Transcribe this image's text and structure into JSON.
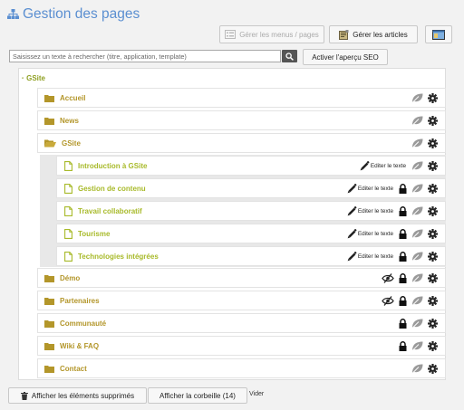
{
  "header": {
    "title": "Gestion des pages",
    "manage_menus_label": "Gérer les menus / pages",
    "manage_articles_label": "Gérer les articles"
  },
  "search": {
    "placeholder": "Saisissez un texte à rechercher (titre, application, template)",
    "value": "",
    "seo_label": "Activer l'aperçu SEO"
  },
  "tree": {
    "root": {
      "label": "GSite"
    },
    "edit_text_label": "Editer le texte",
    "nodes": [
      {
        "label": "Accueil",
        "type": "folder",
        "icons": [
          "leaf",
          "gear"
        ]
      },
      {
        "label": "News",
        "type": "folder",
        "icons": [
          "leaf",
          "gear"
        ]
      },
      {
        "label": "GSite",
        "type": "folder-open",
        "icons": [
          "leaf",
          "gear"
        ]
      },
      {
        "label": "Introduction à GSite",
        "type": "page",
        "icons": [
          "edit",
          "leaf",
          "gear"
        ]
      },
      {
        "label": "Gestion de contenu",
        "type": "page",
        "icons": [
          "edit",
          "lock",
          "leaf",
          "gear"
        ]
      },
      {
        "label": "Travail collaboratif",
        "type": "page",
        "icons": [
          "edit",
          "lock",
          "leaf",
          "gear"
        ]
      },
      {
        "label": "Tourisme",
        "type": "page",
        "icons": [
          "edit",
          "lock",
          "leaf",
          "gear"
        ]
      },
      {
        "label": "Technologies intégrées",
        "type": "page",
        "icons": [
          "edit",
          "lock",
          "leaf",
          "gear"
        ]
      },
      {
        "label": "Démo",
        "type": "folder",
        "icons": [
          "eye-slash",
          "lock",
          "leaf",
          "gear"
        ]
      },
      {
        "label": "Partenaires",
        "type": "folder",
        "icons": [
          "eye-slash",
          "lock",
          "leaf",
          "gear"
        ]
      },
      {
        "label": "Communauté",
        "type": "folder",
        "icons": [
          "lock",
          "leaf",
          "gear"
        ]
      },
      {
        "label": "Wiki & FAQ",
        "type": "folder",
        "icons": [
          "lock",
          "leaf",
          "gear"
        ]
      },
      {
        "label": "Contact",
        "type": "folder",
        "icons": [
          "leaf",
          "gear"
        ]
      }
    ]
  },
  "footer": {
    "show_deleted_label": "Afficher les éléments supprimés",
    "show_trash_label": "Afficher la corbeille (14)",
    "empty_label": "Vider"
  },
  "colors": {
    "title": "#5b8fd1",
    "folder": "#b3962a",
    "page": "#a8ba2a",
    "root": "#8fa023"
  }
}
